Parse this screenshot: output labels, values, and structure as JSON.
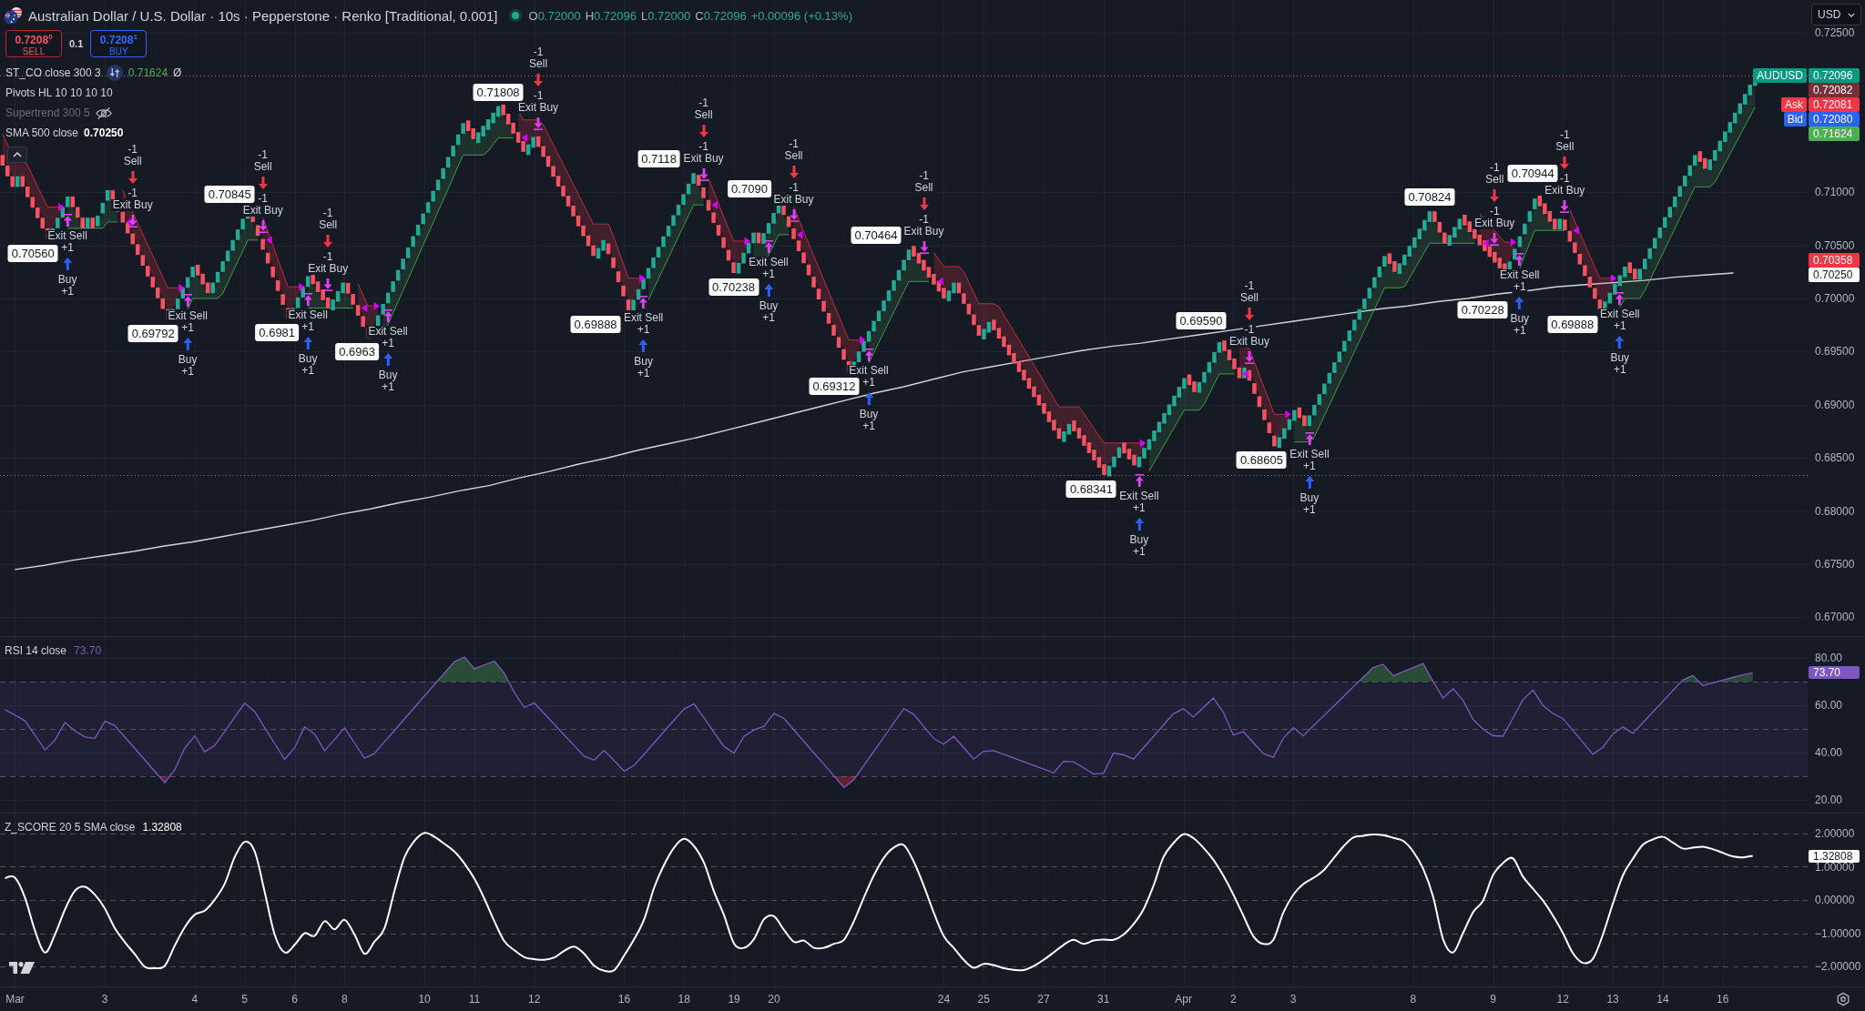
{
  "header": {
    "title": "Australian Dollar / U.S. Dollar · 10s · Pepperstone · Renko [Traditional, 0.001]",
    "market_open": true,
    "ohlc": [
      {
        "label": "O",
        "value": "0.72000"
      },
      {
        "label": "H",
        "value": "0.72096"
      },
      {
        "label": "L",
        "value": "0.72000"
      },
      {
        "label": "C",
        "value": "0.72096"
      }
    ],
    "change": "+0.00096 (+0.13%)"
  },
  "trade": {
    "sell": {
      "price": "0.7208$^{0}$",
      "label": "SELL"
    },
    "quantity": "0.1",
    "buy": {
      "price": "0.7208$^{1}$",
      "label": "BUY"
    }
  },
  "currency": {
    "label": "USD"
  },
  "legend": {
    "expanded": true,
    "indicators": [
      {
        "kind": "strategy",
        "name": "ST_CO close 300 3",
        "value": "0.71624",
        "suffix": "Ø",
        "hidden": false
      },
      {
        "kind": "study",
        "name": "Pivots HL 10 10 10 10",
        "hidden": false
      },
      {
        "kind": "study",
        "name": "Supertrend 300 5",
        "hidden": true
      },
      {
        "kind": "study",
        "name": "SMA 500 close",
        "value": "0.70250",
        "hidden": false
      }
    ]
  },
  "main_pane": {
    "price_tags": [
      {
        "text": "0.72096",
        "caption": "AUDUSD",
        "color": "#089981"
      },
      {
        "text": "0.72082",
        "color": "#7a2e37"
      },
      {
        "text": "0.72081",
        "caption": "Ask",
        "color": "#f23645"
      },
      {
        "text": "0.72080",
        "caption": "Bid",
        "color": "#2962ff"
      },
      {
        "text": "0.71624",
        "color": "#4caf50"
      },
      {
        "text": "0.70358",
        "color": "#f23645"
      },
      {
        "text": "0.70250",
        "color": "#ffffff"
      }
    ],
    "pivot_labels": [
      "0.70560",
      "0.69792",
      "0.70845",
      "0.6981",
      "0.6963",
      "0.71808",
      "0.69888",
      "0.7118",
      "0.70238",
      "0.7090",
      "0.69312",
      "0.70464",
      "0.68341",
      "0.69590",
      "0.68605",
      "0.70824",
      "0.70228",
      "0.70944",
      "0.69888"
    ],
    "orders": [
      {
        "kind": "long",
        "texts": [
          "Exit Sell",
          "+1",
          "Buy",
          "+1"
        ]
      },
      {
        "kind": "short",
        "texts": [
          "-1",
          "Sell",
          "-1",
          "Exit Buy"
        ]
      },
      {
        "kind": "long",
        "texts": [
          "Exit Sell",
          "+1",
          "Buy",
          "+1"
        ]
      },
      {
        "kind": "short",
        "texts": [
          "-1",
          "Sell",
          "-1",
          "Exit Buy"
        ]
      },
      {
        "kind": "long",
        "texts": [
          "Exit Sell",
          "+1",
          "Buy",
          "+1"
        ]
      },
      {
        "kind": "short",
        "texts": [
          "-1",
          "Sell",
          "-1",
          "Exit Buy"
        ]
      },
      {
        "kind": "long",
        "texts": [
          "Exit Sell",
          "+1",
          "Buy",
          "+1"
        ]
      },
      {
        "kind": "short",
        "texts": [
          "-1",
          "Sell",
          "-1",
          "Exit Buy"
        ]
      },
      {
        "kind": "long",
        "texts": [
          "Exit Sell",
          "+1",
          "Buy",
          "+1"
        ]
      },
      {
        "kind": "short",
        "texts": [
          "-1",
          "Sell",
          "-1",
          "Exit Buy"
        ]
      },
      {
        "kind": "long",
        "texts": [
          "Exit Sell",
          "+1",
          "Buy",
          "+1"
        ]
      },
      {
        "kind": "short",
        "texts": [
          "-1",
          "Sell",
          "-1",
          "Exit Buy"
        ]
      },
      {
        "kind": "long",
        "texts": [
          "Exit Sell",
          "+1",
          "Buy",
          "+1"
        ]
      },
      {
        "kind": "short",
        "texts": [
          "-1",
          "Sell",
          "-1",
          "Exit Buy"
        ]
      },
      {
        "kind": "long",
        "texts": [
          "Exit Sell",
          "+1",
          "Buy",
          "+1"
        ]
      },
      {
        "kind": "short",
        "texts": [
          "-1",
          "Sell",
          "-1",
          "Exit Buy"
        ]
      },
      {
        "kind": "long",
        "texts": [
          "Exit Sell",
          "+1",
          "Buy",
          "+1"
        ]
      },
      {
        "kind": "short",
        "texts": [
          "-1",
          "Sell",
          "-1",
          "Exit Buy"
        ]
      },
      {
        "kind": "long",
        "texts": [
          "Exit Sell",
          "+1",
          "Buy",
          "+1"
        ]
      },
      {
        "kind": "short",
        "texts": [
          "-1",
          "Sell",
          "-1",
          "Exit Buy"
        ]
      },
      {
        "kind": "long",
        "texts": [
          "Exit Sell",
          "+1",
          "Buy",
          "+1"
        ]
      }
    ],
    "chart_data": {
      "type": "line",
      "grid": true,
      "ylim": [
        0.66824,
        0.72808
      ],
      "yticks": [
        {
          "value": 0.725,
          "label": "0.72500"
        },
        {
          "value": 0.71,
          "label": "0.71000"
        },
        {
          "value": 0.705,
          "label": "0.70500"
        },
        {
          "value": 0.7,
          "label": "0.70000"
        },
        {
          "value": 0.695,
          "label": "0.69500"
        },
        {
          "value": 0.69,
          "label": "0.69000"
        },
        {
          "value": 0.685,
          "label": "0.68500"
        },
        {
          "value": 0.68,
          "label": "0.68000"
        },
        {
          "value": 0.675,
          "label": "0.67500"
        },
        {
          "value": 0.67,
          "label": "0.67000"
        }
      ],
      "categories": [
        null,
        null,
        null,
        null,
        null,
        null,
        null,
        null,
        null,
        null,
        null,
        null,
        null,
        null,
        null,
        null,
        null,
        null,
        null,
        null,
        null,
        null,
        null,
        null,
        null,
        null,
        null,
        null,
        null,
        null,
        null,
        null,
        null,
        null,
        null,
        null,
        null,
        null,
        null,
        null,
        null,
        null,
        null,
        null,
        null,
        null,
        null,
        null,
        null,
        null,
        null,
        null,
        null,
        null,
        null,
        null,
        null,
        null,
        null,
        null,
        null
      ],
      "series": [
        {
          "color": "#d1d4dc",
          "values": [
            0.6745,
            0.6749,
            0.6754,
            0.6758,
            0.6762,
            0.6767,
            0.6771,
            0.6776,
            0.6781,
            0.6786,
            0.6791,
            0.6797,
            0.6802,
            0.6808,
            0.6813,
            0.6819,
            0.6824,
            0.6831,
            0.6837,
            0.6844,
            0.685,
            0.6857,
            0.6863,
            0.6869,
            0.6876,
            0.6883,
            0.689,
            0.6897,
            0.6904,
            0.6911,
            0.6917,
            0.6924,
            0.6931,
            0.6936,
            0.6941,
            0.6946,
            0.6951,
            0.6955,
            0.6958,
            0.6962,
            0.6966,
            0.697,
            0.6974,
            0.6978,
            0.6982,
            0.6986,
            0.699,
            0.6993,
            0.6997,
            0.7,
            0.7004,
            0.7007,
            0.7011,
            0.7013,
            0.7015,
            0.7017,
            0.702,
            0.7022,
            0.7024,
            null,
            null
          ]
        }
      ],
      "ref_lines": [
        {
          "axis": "y",
          "value": 0.72096,
          "color": "#f7525f"
        },
        {
          "axis": "y",
          "value": 0.68341,
          "color": "#787b86"
        }
      ]
    }
  },
  "rsi_pane": {
    "title": "RSI 14 close",
    "value": "73.70",
    "value_tag": {
      "text": "73.70"
    },
    "chart_data": {
      "type": "line",
      "grid": true,
      "ylim": [
        14.6,
        88.8
      ],
      "yticks": [
        {
          "value": 80,
          "label": "80.00"
        },
        {
          "value": 60,
          "label": "60.00"
        },
        {
          "value": 40,
          "label": "40.00"
        },
        {
          "value": 20,
          "label": "20.00"
        }
      ],
      "categories": [
        null,
        null,
        null,
        null,
        null,
        null,
        null,
        null,
        null,
        null,
        null,
        null,
        null,
        null,
        null,
        null,
        null,
        null,
        null,
        null,
        null,
        null,
        null,
        null,
        null,
        null,
        null,
        null,
        null,
        null,
        null,
        null,
        null,
        null,
        null,
        null,
        null,
        null,
        null,
        null,
        null,
        null,
        null,
        null,
        null,
        null,
        null,
        null,
        null,
        null,
        null,
        null,
        null,
        null,
        null,
        null,
        null,
        null,
        null,
        null,
        null,
        null,
        null,
        null,
        null,
        null,
        null,
        null,
        null,
        null,
        null,
        null,
        null,
        null,
        null,
        null,
        null,
        null,
        null,
        null,
        null,
        null,
        null,
        null,
        null,
        null,
        null,
        null,
        null,
        null,
        null,
        null,
        null,
        null,
        null,
        null,
        null,
        null,
        null,
        null,
        null,
        null,
        null,
        null,
        null,
        null,
        null,
        null,
        null,
        null,
        null,
        null,
        null,
        null,
        null,
        null,
        null,
        null,
        null,
        null,
        null,
        null,
        null,
        null,
        null,
        null,
        null,
        null,
        null,
        null,
        null,
        null,
        null,
        null,
        null,
        null,
        null,
        null,
        null,
        null,
        null,
        null,
        null,
        null,
        null,
        null,
        null,
        null,
        null,
        null,
        null,
        null,
        null,
        null,
        null,
        null,
        null,
        null,
        null,
        null,
        null,
        null,
        null,
        null,
        null,
        null,
        null,
        null,
        null,
        null,
        null,
        null,
        null,
        null,
        null,
        null,
        null,
        null,
        null,
        null,
        null
      ],
      "series": [
        {
          "color": "#7e57c2",
          "values": [
            58.1,
            55.8,
            53.4,
            47.3,
            41.1,
            45.2,
            52.7,
            49.1,
            46.6,
            46.0,
            53.2,
            51.4,
            46.5,
            41.7,
            36.9,
            32.0,
            27.2,
            32.8,
            41.9,
            47.1,
            40.2,
            43.0,
            48.9,
            54.9,
            60.8,
            57.3,
            50.5,
            43.8,
            37.1,
            42.0,
            50.8,
            47.8,
            40.8,
            45.5,
            50.4,
            44.0,
            37.6,
            39.6,
            44.5,
            49.3,
            54.2,
            59.0,
            63.9,
            68.7,
            73.5,
            78.4,
            80.3,
            75.4,
            77.0,
            78.6,
            73.5,
            65.3,
            59.0,
            60.9,
            56.4,
            51.9,
            47.4,
            42.9,
            38.4,
            36.8,
            40.9,
            36.5,
            32.1,
            34.6,
            39.3,
            44.1,
            48.9,
            53.7,
            58.4,
            60.5,
            54.5,
            48.5,
            42.5,
            39.8,
            46.8,
            49.5,
            51.1,
            56.6,
            54.4,
            49.5,
            44.7,
            39.8,
            35.0,
            30.1,
            25.2,
            28.5,
            34.5,
            40.5,
            46.5,
            52.5,
            58.5,
            56.1,
            51.0,
            45.9,
            43.5,
            46.8,
            42.0,
            37.2,
            40.5,
            40.8,
            39.3,
            37.7,
            36.1,
            34.5,
            33.0,
            31.4,
            36.3,
            36.1,
            33.5,
            30.9,
            31.2,
            39.8,
            39.0,
            37.2,
            42.0,
            46.8,
            51.6,
            56.4,
            58.5,
            55.0,
            59.0,
            63.0,
            56.9,
            47.4,
            48.8,
            44.2,
            39.5,
            38.0,
            46.0,
            50.5,
            47.0,
            51.2,
            55.3,
            59.4,
            63.5,
            67.7,
            71.8,
            75.9,
            77.3,
            72.4,
            74.1,
            75.9,
            77.6,
            70.0,
            63.0,
            67.0,
            62.0,
            54.0,
            49.9,
            47.1,
            46.9,
            54.6,
            62.3,
            66.4,
            59.9,
            56.5,
            54.3,
            49.3,
            44.3,
            39.3,
            42.2,
            47.8,
            50.8,
            48.1,
            52.6,
            57.1,
            61.6,
            66.1,
            70.6,
            72.5,
            68.3,
            69.4,
            70.6,
            71.7,
            72.8,
            73.7,
            null,
            null,
            null,
            null,
            null
          ]
        }
      ],
      "bands": [
        {
          "axis": "y",
          "from": 30,
          "to": 70
        }
      ],
      "ref_lines": [
        {
          "axis": "y",
          "value": 70
        },
        {
          "axis": "y",
          "value": 50
        },
        {
          "axis": "y",
          "value": 30
        }
      ]
    }
  },
  "zscore_pane": {
    "title": "Z_SCORE 20 5 SMA close",
    "value": "1.32808",
    "value_tag": {
      "text": "1.32808"
    },
    "chart_data": {
      "type": "line",
      "grid": true,
      "ylim": [
        -2.6,
        2.6
      ],
      "categories": [
        null,
        "Mar",
        null,
        null,
        null,
        null,
        null,
        null,
        null,
        null,
        "3",
        null,
        null,
        null,
        null,
        null,
        null,
        null,
        null,
        "4",
        null,
        null,
        null,
        null,
        "5",
        null,
        null,
        null,
        null,
        "6",
        null,
        null,
        null,
        null,
        "8",
        null,
        null,
        null,
        null,
        null,
        null,
        null,
        "10",
        null,
        null,
        null,
        null,
        "11",
        null,
        null,
        null,
        null,
        null,
        "12",
        null,
        null,
        null,
        null,
        null,
        null,
        null,
        null,
        "16",
        null,
        null,
        null,
        null,
        null,
        "18",
        null,
        null,
        null,
        null,
        "19",
        null,
        null,
        null,
        "20",
        null,
        null,
        null,
        null,
        null,
        null,
        null,
        null,
        null,
        null,
        null,
        null,
        null,
        null,
        null,
        null,
        "24",
        null,
        null,
        null,
        "25",
        null,
        null,
        null,
        null,
        null,
        "27",
        null,
        null,
        null,
        null,
        null,
        "31",
        null,
        null,
        null,
        null,
        null,
        null,
        null,
        "Apr",
        null,
        null,
        null,
        null,
        "2",
        null,
        null,
        null,
        null,
        null,
        "3",
        null,
        null,
        null,
        null,
        null,
        null,
        null,
        null,
        null,
        null,
        null,
        "8",
        null,
        null,
        null,
        null,
        null,
        null,
        null,
        "9",
        null,
        null,
        null,
        null,
        null,
        null,
        "12",
        null,
        null,
        null,
        null,
        "13",
        null,
        null,
        null,
        null,
        "14",
        null,
        null,
        null,
        null,
        null,
        "16",
        null,
        null,
        null,
        null,
        null,
        null,
        null,
        null
      ],
      "yticks": [
        {
          "value": 2,
          "label": "2.00000"
        },
        {
          "value": 1,
          "label": "1.00000"
        },
        {
          "value": 0,
          "label": "0.00000"
        },
        {
          "value": -1,
          "label": "−1.00000"
        },
        {
          "value": -2,
          "label": "−2.00000"
        }
      ],
      "series": [
        {
          "color": "#ffffff",
          "values": [
            0.66,
            0.67,
            0.07,
            -0.92,
            -1.58,
            -1.04,
            -0.29,
            0.28,
            0.4,
            0.16,
            -0.26,
            -0.85,
            -1.27,
            -1.63,
            -2.01,
            -2.05,
            -1.98,
            -1.37,
            -0.82,
            -0.44,
            -0.32,
            0.01,
            0.49,
            1.29,
            1.75,
            1.46,
            0.25,
            -1.04,
            -1.58,
            -1.35,
            -1.0,
            -1.08,
            -0.64,
            -0.88,
            -0.6,
            -1.04,
            -1.62,
            -1.25,
            -0.85,
            0.27,
            1.29,
            1.78,
            2.02,
            1.9,
            1.69,
            1.46,
            1.1,
            0.64,
            0.04,
            -0.64,
            -1.24,
            -1.51,
            -1.72,
            -1.78,
            -1.8,
            -1.73,
            -1.53,
            -1.4,
            -1.62,
            -1.98,
            -2.13,
            -2.11,
            -1.67,
            -1.18,
            -0.58,
            0.37,
            1.06,
            1.58,
            1.84,
            1.62,
            1.11,
            0.25,
            -0.46,
            -1.31,
            -1.44,
            -1.17,
            -0.58,
            -0.49,
            -0.9,
            -1.26,
            -1.22,
            -1.44,
            -1.44,
            -1.32,
            -1.2,
            -0.64,
            0.07,
            0.74,
            1.27,
            1.58,
            1.65,
            1.15,
            0.43,
            -0.38,
            -1.09,
            -1.44,
            -1.8,
            -2.04,
            -1.92,
            -1.96,
            -2.05,
            -2.1,
            -2.11,
            -1.99,
            -1.8,
            -1.58,
            -1.35,
            -1.2,
            -1.32,
            -1.22,
            -1.19,
            -1.2,
            -1.04,
            -0.73,
            -0.28,
            0.43,
            1.29,
            1.71,
            1.98,
            1.86,
            1.57,
            1.21,
            0.73,
            0.16,
            -0.47,
            -1.09,
            -1.32,
            -1.2,
            -0.38,
            0.16,
            0.48,
            0.66,
            0.88,
            1.24,
            1.6,
            1.88,
            1.93,
            1.97,
            1.95,
            1.87,
            1.78,
            1.46,
            0.94,
            0.1,
            -1.18,
            -1.58,
            -0.99,
            -0.37,
            -0.02,
            0.75,
            1.11,
            1.25,
            0.7,
            0.34,
            -0.02,
            -0.47,
            -1.0,
            -1.6,
            -1.89,
            -1.77,
            -1.04,
            -0.11,
            0.74,
            1.24,
            1.66,
            1.82,
            1.9,
            1.73,
            1.55,
            1.57,
            1.6,
            1.53,
            1.42,
            1.31,
            1.28,
            1.33,
            null,
            null,
            null,
            null,
            null
          ]
        }
      ],
      "ref_lines": [
        {
          "axis": "y",
          "value": 2
        },
        {
          "axis": "y",
          "value": 1
        },
        {
          "axis": "y",
          "value": 0
        },
        {
          "axis": "y",
          "value": -1
        },
        {
          "axis": "y",
          "value": -2
        }
      ]
    }
  }
}
